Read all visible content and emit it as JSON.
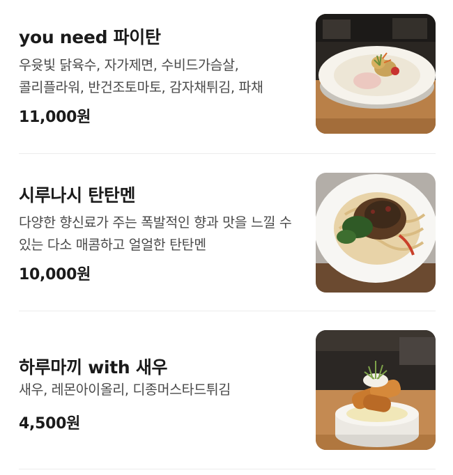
{
  "menu": {
    "items": [
      {
        "name": "you need 파이탄",
        "description": "우윳빛 닭육수, 자가제면, 수비드가슴살, 콜리플라워, 반건조토마토, 감자채튀김, 파채",
        "price": "11,000원",
        "image_icon": "paitan-ramen-photo"
      },
      {
        "name": "시루나시 탄탄멘",
        "description": "다양한 향신료가 주는 폭발적인 향과 맛을 느낄 수 있는 다소 매콤하고 얼얼한 탄탄멘",
        "price": "10,000원",
        "image_icon": "tantanmen-photo"
      },
      {
        "name": "하루마끼 with 새우",
        "description": "새우, 레몬아이올리, 디종머스타드튀김",
        "price": "4,500원",
        "image_icon": "harumaki-shrimp-photo"
      }
    ]
  }
}
